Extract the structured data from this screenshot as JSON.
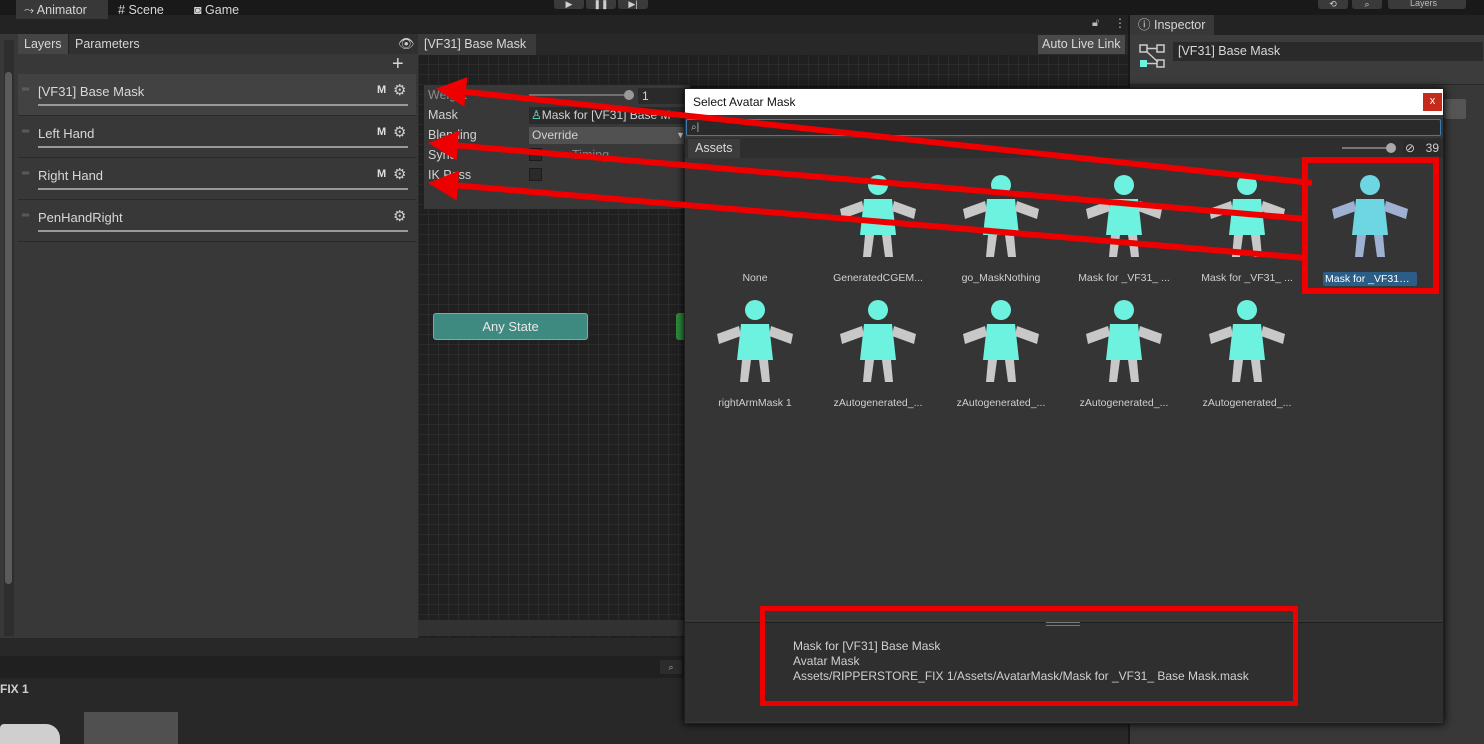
{
  "tabs": {
    "animator": "Animator",
    "scene": "Scene",
    "game": "Game",
    "inspector": "Inspector"
  },
  "toolbar": {
    "play": "▶",
    "pause": "❚❚",
    "step": "▶|",
    "layers_dropdown": "Layers"
  },
  "animator": {
    "subtabs": {
      "layers": "Layers",
      "parameters": "Parameters"
    },
    "breadcrumb": "[VF31] Base Mask",
    "auto_live_link": "Auto Live Link",
    "layers": [
      {
        "name": "[VF31] Base Mask",
        "m": "M"
      },
      {
        "name": "Left Hand",
        "m": "M"
      },
      {
        "name": "Right Hand",
        "m": "M"
      },
      {
        "name": "PenHandRight",
        "m": ""
      }
    ],
    "settings": {
      "weight_label": "Weight",
      "weight_value": "1",
      "mask_label": "Mask",
      "mask_value": "Mask for [VF31] Base M",
      "blending_label": "Blending",
      "blending_value": "Override",
      "sync_label": "Sync",
      "sync_timing_label": "Timing",
      "ik_label": "IK Pass"
    },
    "any_state": "Any State"
  },
  "bottom": {
    "label": "FIX 1"
  },
  "inspector": {
    "object_name": "[VF31] Base Mask"
  },
  "picker": {
    "title": "Select Avatar Mask",
    "close": "x",
    "search_value": "",
    "assets_tab": "Assets",
    "count": "39",
    "items": [
      {
        "label": "None"
      },
      {
        "label": "GeneratedCGEM..."
      },
      {
        "label": "go_MaskNothing"
      },
      {
        "label": "Mask for _VF31_ ..."
      },
      {
        "label": "Mask for _VF31_ ..."
      },
      {
        "label": "Mask for _VF31_ ..."
      },
      {
        "label": "rightArmMask 1"
      },
      {
        "label": "zAutogenerated_..."
      },
      {
        "label": "zAutogenerated_..."
      },
      {
        "label": "zAutogenerated_..."
      },
      {
        "label": "zAutogenerated_..."
      }
    ],
    "details": {
      "name": "Mask for [VF31] Base Mask",
      "type": "Avatar Mask",
      "path": "Assets/RIPPERSTORE_FIX 1/Assets/AvatarMask/Mask for _VF31_ Base Mask.mask"
    }
  },
  "colors": {
    "annotation_red": "#ee0000",
    "mask_body": "#6cf2de",
    "selection": "#2c5d87",
    "any_state": "#3e8a80"
  }
}
